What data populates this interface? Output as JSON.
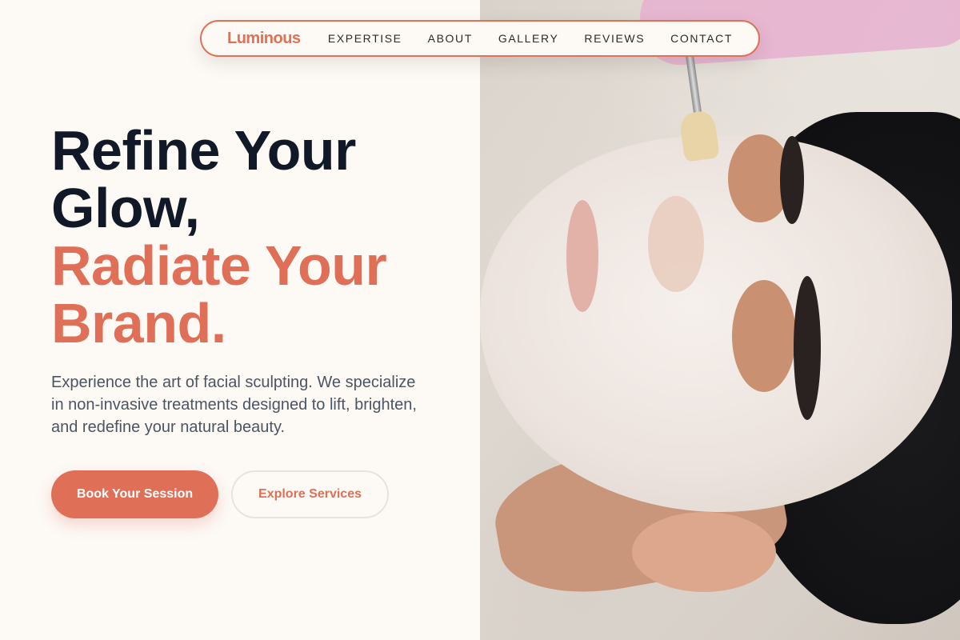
{
  "brand": {
    "name": "Luminous",
    "accent": "#e06f57",
    "dark": "#111827"
  },
  "nav": {
    "links": [
      "EXPERTISE",
      "ABOUT",
      "GALLERY",
      "REVIEWS",
      "CONTACT"
    ]
  },
  "hero": {
    "title_line1": "Refine Your",
    "title_line2": "Glow,",
    "accent_line1": "Radiate Your",
    "accent_line2": "Brand.",
    "description": "Experience the art of facial sculpting. We specialize in non-invasive treatments designed to lift, brighten, and redefine your natural beauty.",
    "primary_cta": "Book Your Session",
    "secondary_cta": "Explore Services"
  },
  "image": {
    "subject": "hero-photo"
  }
}
